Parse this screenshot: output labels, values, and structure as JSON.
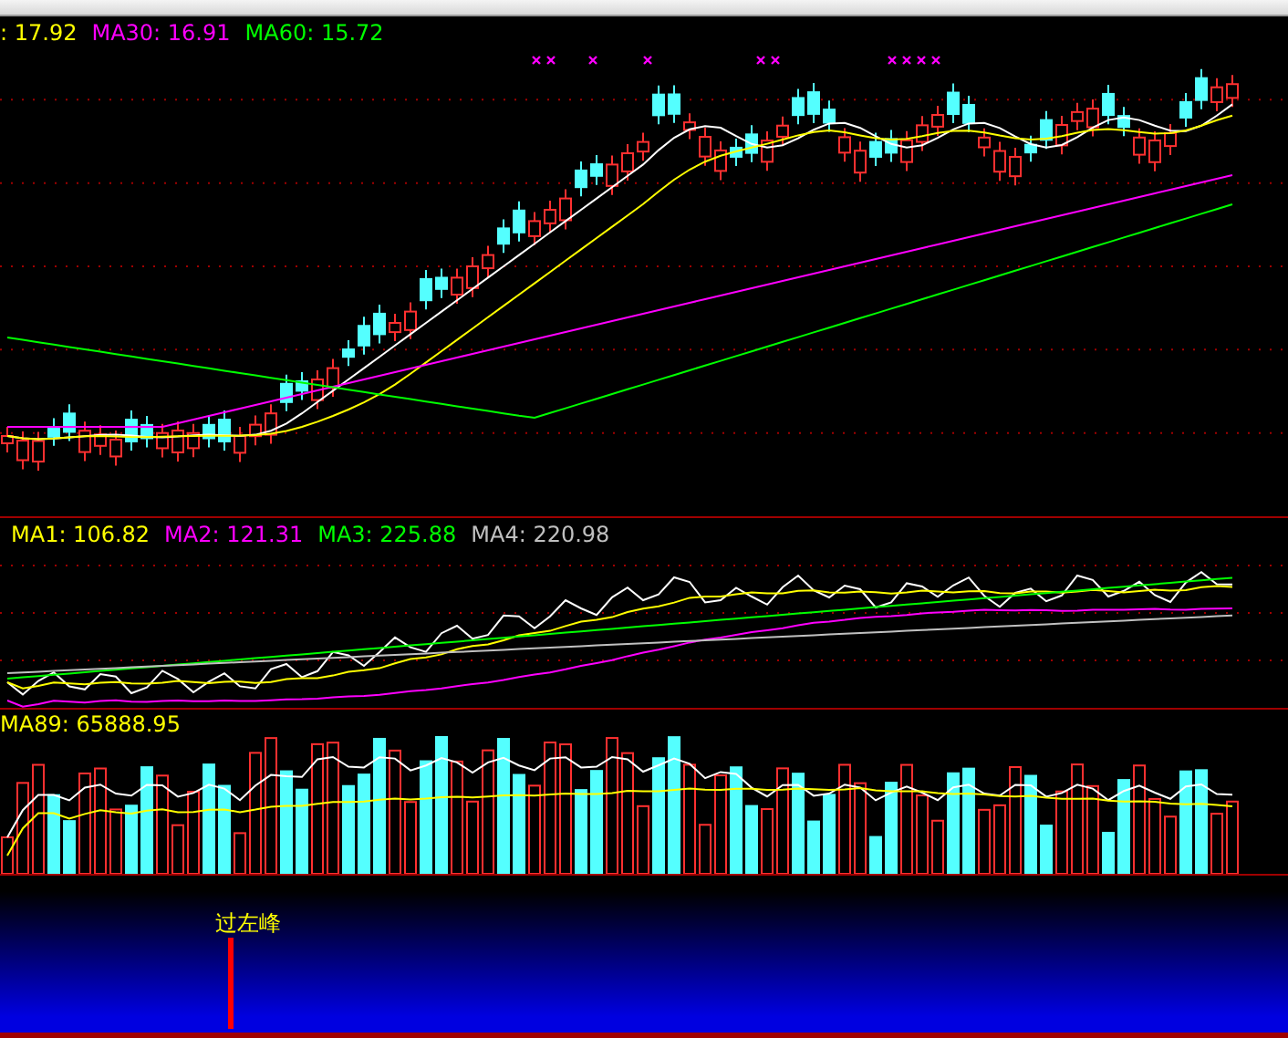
{
  "price_panel": {
    "legend": [
      {
        "text": ": 17.92",
        "color": "#ffff00"
      },
      {
        "text": "MA30: 16.91",
        "color": "#ff00ff"
      },
      {
        "text": "MA60: 15.72",
        "color": "#00ff00"
      }
    ]
  },
  "indicator_panel": {
    "legend": [
      {
        "text": "MA1: 106.82",
        "color": "#ffff00"
      },
      {
        "text": "MA2: 121.31",
        "color": "#ff00ff"
      },
      {
        "text": "MA3: 225.88",
        "color": "#00ff00"
      },
      {
        "text": "MA4: 220.98",
        "color": "#c0c0c0"
      }
    ]
  },
  "volume_panel": {
    "legend": [
      {
        "text": "MA89: 65888.95",
        "color": "#ffff00"
      }
    ]
  },
  "signal_panel": {
    "label": "过左峰"
  }
}
